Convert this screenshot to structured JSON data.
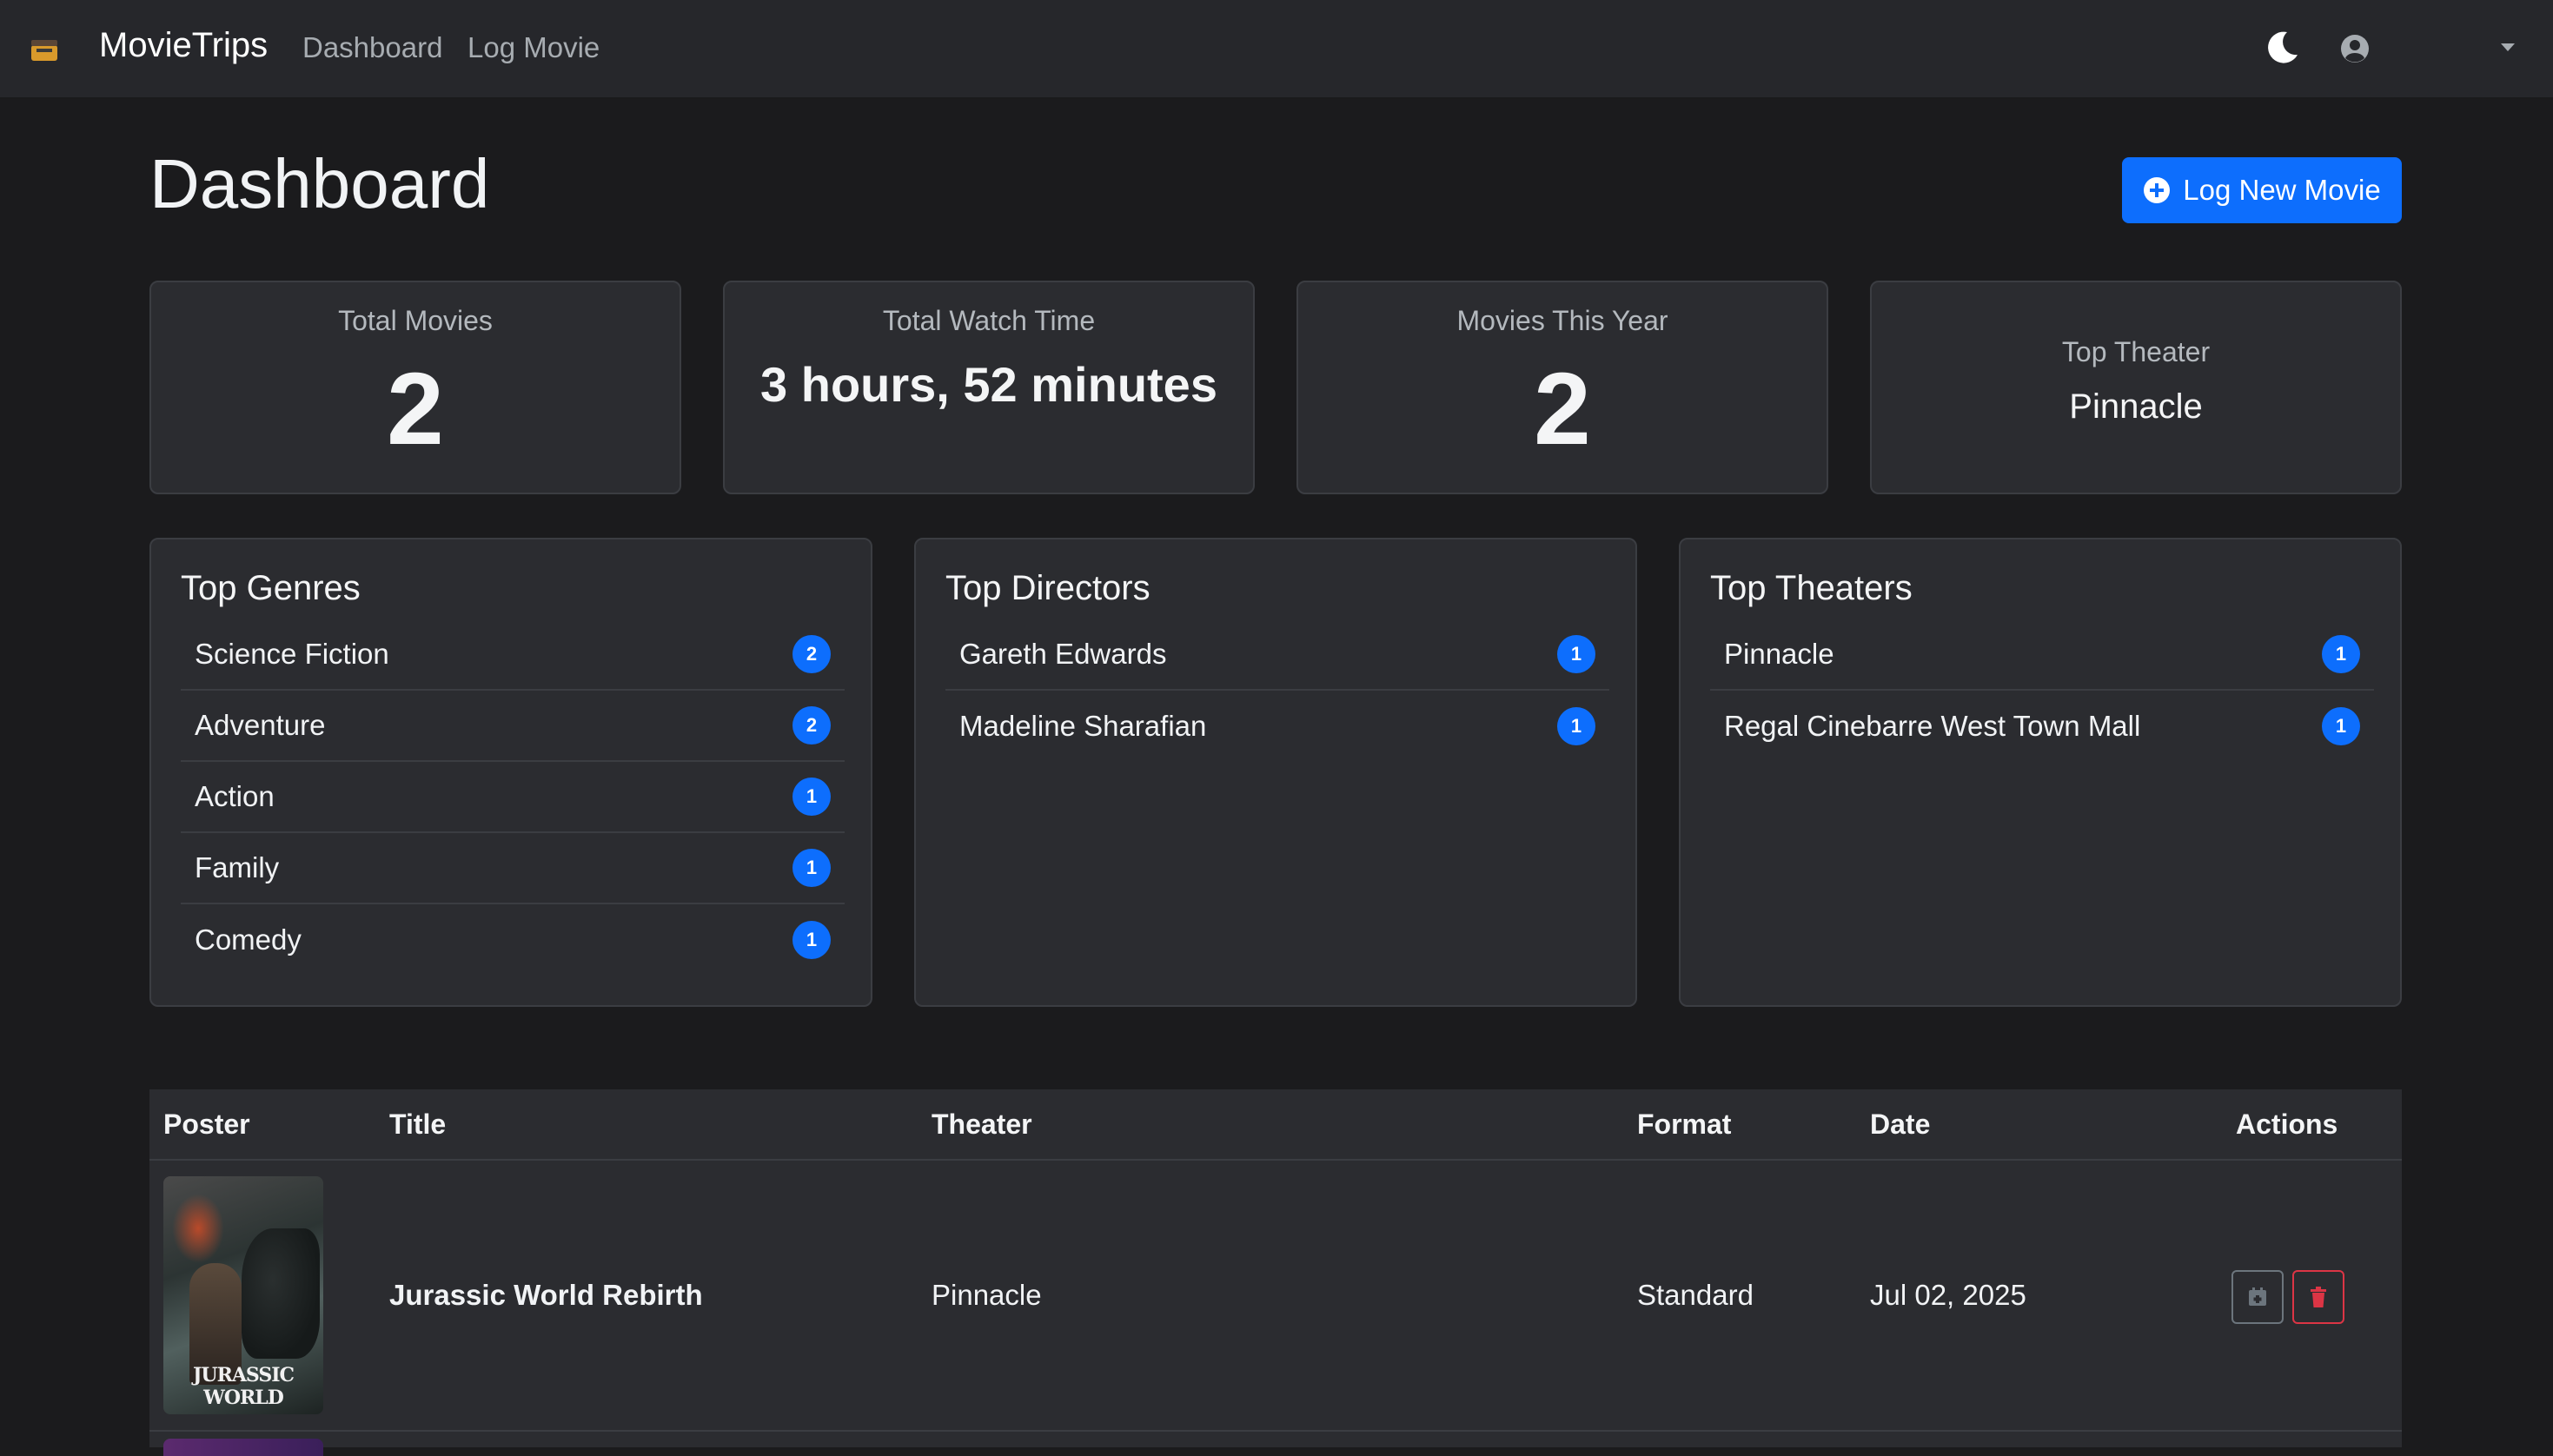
{
  "nav": {
    "brand": "MovieTrips",
    "links": [
      "Dashboard",
      "Log Movie"
    ]
  },
  "header": {
    "title": "Dashboard",
    "log_button": "Log New Movie"
  },
  "stats": [
    {
      "label": "Total Movies",
      "value": "2"
    },
    {
      "label": "Total Watch Time",
      "value": "3 hours, 52 minutes"
    },
    {
      "label": "Movies This Year",
      "value": "2"
    },
    {
      "label": "Top Theater",
      "value": "Pinnacle"
    }
  ],
  "top_genres": {
    "title": "Top Genres",
    "items": [
      {
        "name": "Science Fiction",
        "count": "2"
      },
      {
        "name": "Adventure",
        "count": "2"
      },
      {
        "name": "Action",
        "count": "1"
      },
      {
        "name": "Family",
        "count": "1"
      },
      {
        "name": "Comedy",
        "count": "1"
      }
    ]
  },
  "top_directors": {
    "title": "Top Directors",
    "items": [
      {
        "name": "Gareth Edwards",
        "count": "1"
      },
      {
        "name": "Madeline Sharafian",
        "count": "1"
      }
    ]
  },
  "top_theaters": {
    "title": "Top Theaters",
    "items": [
      {
        "name": "Pinnacle",
        "count": "1"
      },
      {
        "name": "Regal Cinebarre West Town Mall",
        "count": "1"
      }
    ]
  },
  "table": {
    "columns": [
      "Poster",
      "Title",
      "Theater",
      "Format",
      "Date",
      "Actions"
    ],
    "rows": [
      {
        "poster_text": "JURASSIC WORLD",
        "title": "Jurassic World Rebirth",
        "theater": "Pinnacle",
        "format": "Standard",
        "date": "Jul 02, 2025"
      }
    ]
  },
  "colors": {
    "accent": "#0d6efd",
    "danger": "#dc3545",
    "bg": "#1b1b1d",
    "card": "#2b2c30"
  },
  "icons": [
    "clapperboard-icon",
    "moon-icon",
    "user-circle-icon",
    "chevron-down-icon",
    "plus-circle-icon",
    "calendar-edit-icon",
    "trash-icon"
  ]
}
